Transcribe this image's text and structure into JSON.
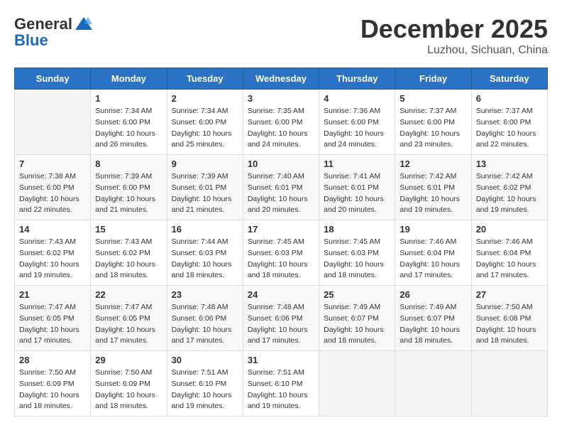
{
  "header": {
    "logo_line1": "General",
    "logo_line2": "Blue",
    "month": "December 2025",
    "location": "Luzhou, Sichuan, China"
  },
  "weekdays": [
    "Sunday",
    "Monday",
    "Tuesday",
    "Wednesday",
    "Thursday",
    "Friday",
    "Saturday"
  ],
  "weeks": [
    [
      {
        "day": "",
        "info": ""
      },
      {
        "day": "1",
        "info": "Sunrise: 7:34 AM\nSunset: 6:00 PM\nDaylight: 10 hours\nand 26 minutes."
      },
      {
        "day": "2",
        "info": "Sunrise: 7:34 AM\nSunset: 6:00 PM\nDaylight: 10 hours\nand 25 minutes."
      },
      {
        "day": "3",
        "info": "Sunrise: 7:35 AM\nSunset: 6:00 PM\nDaylight: 10 hours\nand 24 minutes."
      },
      {
        "day": "4",
        "info": "Sunrise: 7:36 AM\nSunset: 6:00 PM\nDaylight: 10 hours\nand 24 minutes."
      },
      {
        "day": "5",
        "info": "Sunrise: 7:37 AM\nSunset: 6:00 PM\nDaylight: 10 hours\nand 23 minutes."
      },
      {
        "day": "6",
        "info": "Sunrise: 7:37 AM\nSunset: 6:00 PM\nDaylight: 10 hours\nand 22 minutes."
      }
    ],
    [
      {
        "day": "7",
        "info": "Sunrise: 7:38 AM\nSunset: 6:00 PM\nDaylight: 10 hours\nand 22 minutes."
      },
      {
        "day": "8",
        "info": "Sunrise: 7:39 AM\nSunset: 6:00 PM\nDaylight: 10 hours\nand 21 minutes."
      },
      {
        "day": "9",
        "info": "Sunrise: 7:39 AM\nSunset: 6:01 PM\nDaylight: 10 hours\nand 21 minutes."
      },
      {
        "day": "10",
        "info": "Sunrise: 7:40 AM\nSunset: 6:01 PM\nDaylight: 10 hours\nand 20 minutes."
      },
      {
        "day": "11",
        "info": "Sunrise: 7:41 AM\nSunset: 6:01 PM\nDaylight: 10 hours\nand 20 minutes."
      },
      {
        "day": "12",
        "info": "Sunrise: 7:42 AM\nSunset: 6:01 PM\nDaylight: 10 hours\nand 19 minutes."
      },
      {
        "day": "13",
        "info": "Sunrise: 7:42 AM\nSunset: 6:02 PM\nDaylight: 10 hours\nand 19 minutes."
      }
    ],
    [
      {
        "day": "14",
        "info": "Sunrise: 7:43 AM\nSunset: 6:02 PM\nDaylight: 10 hours\nand 19 minutes."
      },
      {
        "day": "15",
        "info": "Sunrise: 7:43 AM\nSunset: 6:02 PM\nDaylight: 10 hours\nand 18 minutes."
      },
      {
        "day": "16",
        "info": "Sunrise: 7:44 AM\nSunset: 6:03 PM\nDaylight: 10 hours\nand 18 minutes."
      },
      {
        "day": "17",
        "info": "Sunrise: 7:45 AM\nSunset: 6:03 PM\nDaylight: 10 hours\nand 18 minutes."
      },
      {
        "day": "18",
        "info": "Sunrise: 7:45 AM\nSunset: 6:03 PM\nDaylight: 10 hours\nand 18 minutes."
      },
      {
        "day": "19",
        "info": "Sunrise: 7:46 AM\nSunset: 6:04 PM\nDaylight: 10 hours\nand 17 minutes."
      },
      {
        "day": "20",
        "info": "Sunrise: 7:46 AM\nSunset: 6:04 PM\nDaylight: 10 hours\nand 17 minutes."
      }
    ],
    [
      {
        "day": "21",
        "info": "Sunrise: 7:47 AM\nSunset: 6:05 PM\nDaylight: 10 hours\nand 17 minutes."
      },
      {
        "day": "22",
        "info": "Sunrise: 7:47 AM\nSunset: 6:05 PM\nDaylight: 10 hours\nand 17 minutes."
      },
      {
        "day": "23",
        "info": "Sunrise: 7:48 AM\nSunset: 6:06 PM\nDaylight: 10 hours\nand 17 minutes."
      },
      {
        "day": "24",
        "info": "Sunrise: 7:48 AM\nSunset: 6:06 PM\nDaylight: 10 hours\nand 17 minutes."
      },
      {
        "day": "25",
        "info": "Sunrise: 7:49 AM\nSunset: 6:07 PM\nDaylight: 10 hours\nand 18 minutes."
      },
      {
        "day": "26",
        "info": "Sunrise: 7:49 AM\nSunset: 6:07 PM\nDaylight: 10 hours\nand 18 minutes."
      },
      {
        "day": "27",
        "info": "Sunrise: 7:50 AM\nSunset: 6:08 PM\nDaylight: 10 hours\nand 18 minutes."
      }
    ],
    [
      {
        "day": "28",
        "info": "Sunrise: 7:50 AM\nSunset: 6:09 PM\nDaylight: 10 hours\nand 18 minutes."
      },
      {
        "day": "29",
        "info": "Sunrise: 7:50 AM\nSunset: 6:09 PM\nDaylight: 10 hours\nand 18 minutes."
      },
      {
        "day": "30",
        "info": "Sunrise: 7:51 AM\nSunset: 6:10 PM\nDaylight: 10 hours\nand 19 minutes."
      },
      {
        "day": "31",
        "info": "Sunrise: 7:51 AM\nSunset: 6:10 PM\nDaylight: 10 hours\nand 19 minutes."
      },
      {
        "day": "",
        "info": ""
      },
      {
        "day": "",
        "info": ""
      },
      {
        "day": "",
        "info": ""
      }
    ]
  ]
}
